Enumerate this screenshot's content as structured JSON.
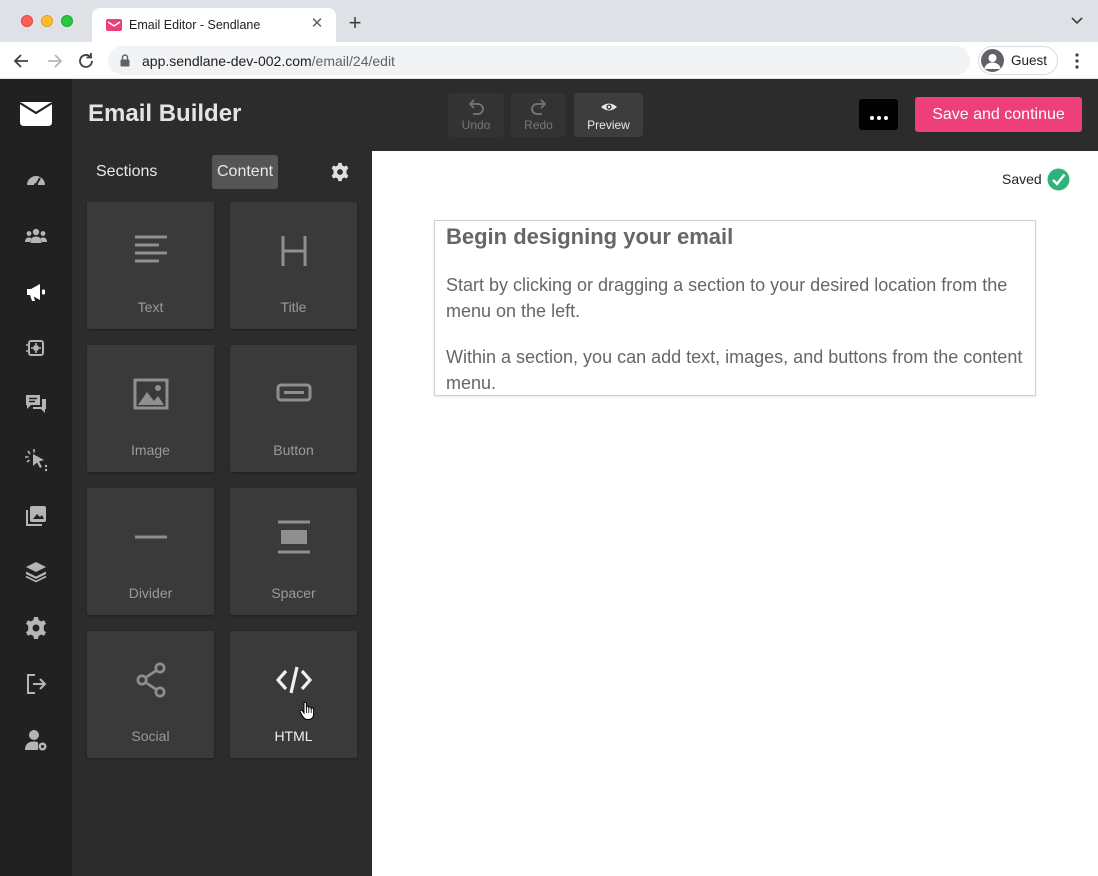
{
  "browser": {
    "tab_title": "Email Editor - Sendlane",
    "url_host": "app.sendlane-dev-002.com",
    "url_path": "/email/24/edit",
    "profile_name": "Guest"
  },
  "nav": {
    "items": [
      {
        "name": "dashboard-icon"
      },
      {
        "name": "contacts-icon"
      },
      {
        "name": "campaigns-icon"
      },
      {
        "name": "automations-icon"
      },
      {
        "name": "conversations-icon"
      },
      {
        "name": "tracking-icon"
      },
      {
        "name": "media-icon"
      },
      {
        "name": "integrations-icon"
      },
      {
        "name": "settings-icon"
      },
      {
        "name": "logout-icon"
      },
      {
        "name": "account-settings-icon"
      }
    ]
  },
  "header": {
    "title": "Email Builder",
    "undo_label": "Undo",
    "redo_label": "Redo",
    "preview_label": "Preview",
    "save_label": "Save and continue"
  },
  "panel": {
    "tabs": [
      {
        "label": "Sections",
        "active": false
      },
      {
        "label": "Content",
        "active": true
      }
    ],
    "blocks": [
      {
        "label": "Text",
        "icon": "text-icon"
      },
      {
        "label": "Title",
        "icon": "title-icon"
      },
      {
        "label": "Image",
        "icon": "image-icon"
      },
      {
        "label": "Button",
        "icon": "button-icon"
      },
      {
        "label": "Divider",
        "icon": "divider-icon"
      },
      {
        "label": "Spacer",
        "icon": "spacer-icon"
      },
      {
        "label": "Social",
        "icon": "share-icon"
      },
      {
        "label": "HTML",
        "icon": "code-icon"
      }
    ]
  },
  "canvas": {
    "status": "Saved",
    "heading": "Begin designing your email",
    "paragraph1": "Start by clicking or dragging a section to your desired location from the menu on the left.",
    "paragraph2": "Within a section, you can add text, images, and buttons from the content menu."
  },
  "colors": {
    "accent": "#ef3e7c",
    "success": "#2fb37a",
    "sidebar": "#212121",
    "panel": "#2c2c2c"
  }
}
